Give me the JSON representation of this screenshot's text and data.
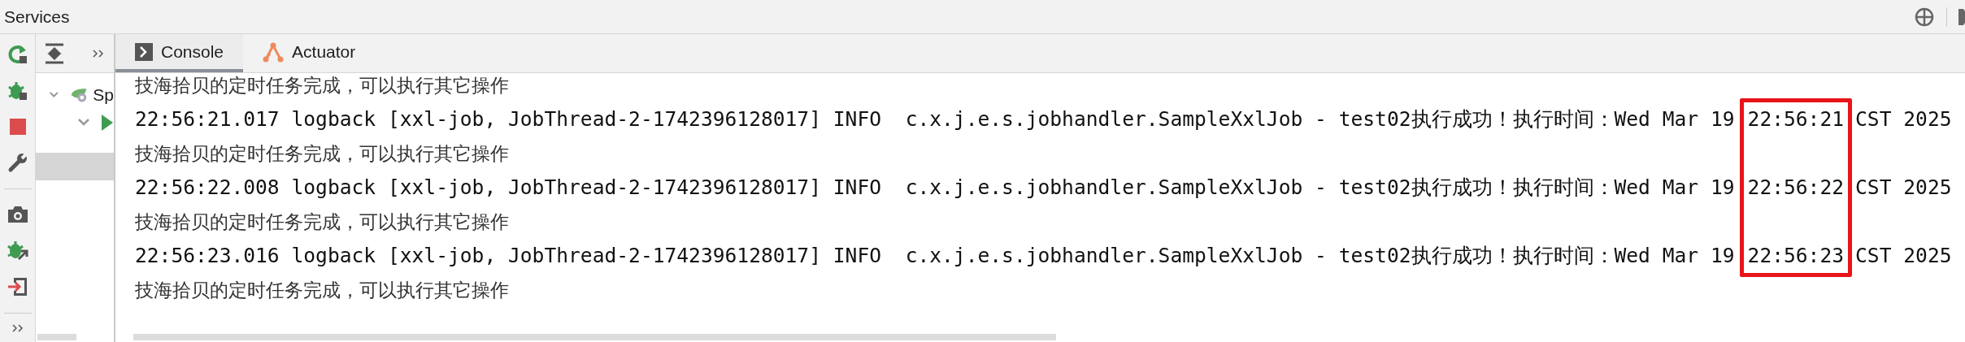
{
  "window": {
    "title": "Services"
  },
  "tree": [
    {
      "label": "Sp",
      "expanded": true,
      "children": [
        {
          "kind": "run",
          "expanded": true
        }
      ]
    }
  ],
  "tabs": [
    {
      "label": "Console",
      "kind": "console",
      "selected": true
    },
    {
      "label": "Actuator",
      "kind": "actuator",
      "selected": false
    }
  ],
  "console": {
    "lines": [
      {
        "kind": "message",
        "text": "技海拾贝的定时任务完成，可以执行其它操作"
      },
      {
        "kind": "log",
        "prefix": "22:56:21.017 logback [xxl-job, JobThread-2-1742396128017] INFO  c.x.j.e.s.jobhandler.SampleXxlJob - test02执行成功！执行时间：Wed Mar 19",
        "time": "22:56:21",
        "suffix": "CST 2025",
        "highlighted": true
      },
      {
        "kind": "message",
        "text": "技海拾贝的定时任务完成，可以执行其它操作"
      },
      {
        "kind": "log",
        "prefix": "22:56:22.008 logback [xxl-job, JobThread-2-1742396128017] INFO  c.x.j.e.s.jobhandler.SampleXxlJob - test02执行成功！执行时间：Wed Mar 19",
        "time": "22:56:22",
        "suffix": "CST 2025",
        "highlighted": true
      },
      {
        "kind": "message",
        "text": "技海拾贝的定时任务完成，可以执行其它操作"
      },
      {
        "kind": "log",
        "prefix": "22:56:23.016 logback [xxl-job, JobThread-2-1742396128017] INFO  c.x.j.e.s.jobhandler.SampleXxlJob - test02执行成功！执行时间：Wed Mar 19",
        "time": "22:56:23",
        "suffix": "CST 2025",
        "highlighted": true
      },
      {
        "kind": "message",
        "text": "技海拾贝的定时任务完成，可以执行其它操作"
      }
    ]
  }
}
